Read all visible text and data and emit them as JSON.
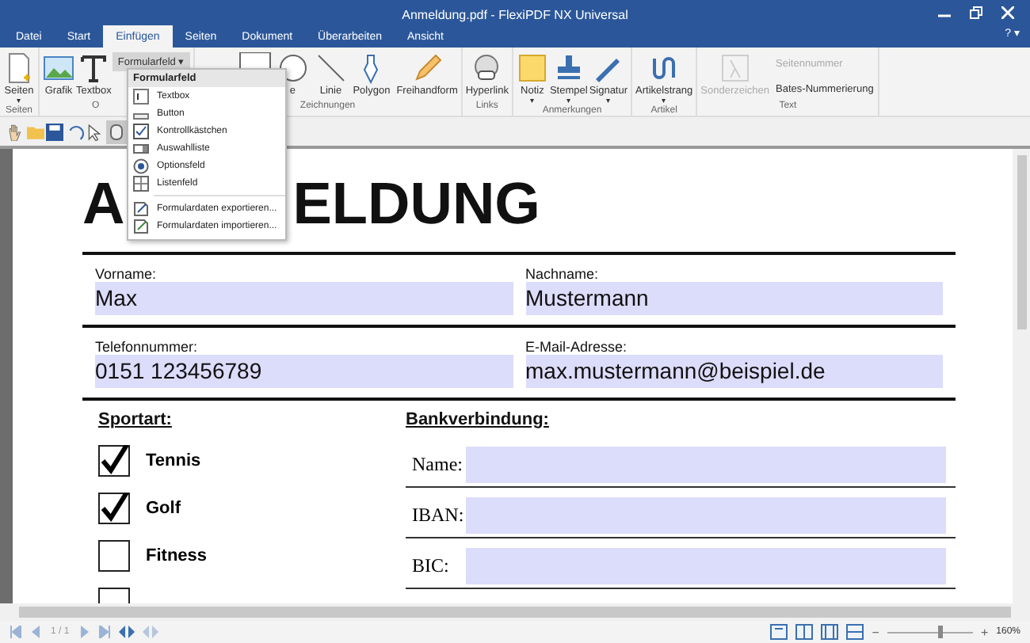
{
  "window": {
    "title": "Anmeldung.pdf - FlexiPDF NX Universal",
    "help": "? ▾"
  },
  "tabs": [
    {
      "label": "Datei",
      "selected": false
    },
    {
      "label": "Start",
      "selected": false
    },
    {
      "label": "Einfügen",
      "selected": true
    },
    {
      "label": "Seiten",
      "selected": false
    },
    {
      "label": "Dokument",
      "selected": false
    },
    {
      "label": "Überarbeiten",
      "selected": false
    },
    {
      "label": "Ansicht",
      "selected": false
    }
  ],
  "ribbon": [
    {
      "label": "Seiten",
      "items": [
        {
          "label": "Seiten",
          "kind": "page",
          "dropdown": "▾"
        }
      ]
    },
    {
      "label": "O",
      "items": [
        {
          "label": "Grafik",
          "kind": "image"
        },
        {
          "label": "Textbox",
          "kind": "text"
        },
        {
          "label": "Formularfeld ▾",
          "kind": "form"
        }
      ]
    },
    {
      "label": "Zeichnungen",
      "items": [
        {
          "kind": "rect"
        },
        {
          "label": "e",
          "kind": "ellipse"
        },
        {
          "label": "Linie",
          "kind": "line"
        },
        {
          "label": "Polygon",
          "kind": "pen"
        },
        {
          "label": "Freihandform",
          "kind": "pencil"
        }
      ]
    },
    {
      "label": "Links",
      "items": [
        {
          "label": "Hyperlink",
          "kind": "globe"
        }
      ]
    },
    {
      "label": "Anmerkungen",
      "items": [
        {
          "label": "Notiz",
          "kind": "note",
          "dropdown": "▾"
        },
        {
          "label": "Stempel",
          "kind": "stamp",
          "dropdown": "▾"
        },
        {
          "label": "Signatur",
          "kind": "sign",
          "dropdown": "▾"
        }
      ]
    },
    {
      "label": "Artikel",
      "items": [
        {
          "label": "Artikelstrang",
          "kind": "thread",
          "dropdown": "▾"
        }
      ]
    },
    {
      "label": "Text",
      "items": [
        {
          "label": "Sonderzeichen",
          "kind": "lambda",
          "disabled": true
        },
        {
          "label": "Seitennummer",
          "kind": "small",
          "disabled": true
        },
        {
          "label": "Bates-Nummerierung",
          "kind": "bates",
          "disabled": false
        }
      ]
    }
  ],
  "menu": {
    "title": "Formularfeld",
    "items": [
      {
        "label": "Textbox",
        "kind": "textbox"
      },
      {
        "label": "Button",
        "kind": "button"
      },
      {
        "label": "Kontrollkästchen",
        "kind": "checkbox"
      },
      {
        "label": "Auswahlliste",
        "kind": "combo"
      },
      {
        "label": "Optionsfeld",
        "kind": "radio"
      },
      {
        "label": "Listenfeld",
        "kind": "list"
      },
      {
        "label": "Formulardaten exportieren...",
        "kind": "export"
      },
      {
        "label": "Formulardaten importieren...",
        "kind": "import"
      }
    ]
  },
  "document": {
    "heading_parts": [
      "A",
      "ELDUNG"
    ],
    "field_rows": [
      [
        {
          "label": "Vorname:",
          "value": "Max"
        },
        {
          "label": "Nachname:",
          "value": "Mustermann"
        }
      ],
      [
        {
          "label": "Telefonnummer:",
          "value": "0151 123456789"
        },
        {
          "label": "E-Mail-Adresse:",
          "value": "max.mustermann@beispiel.de"
        }
      ]
    ],
    "sport": {
      "title": "Sportart:",
      "options": [
        {
          "label": "Tennis",
          "checked": true
        },
        {
          "label": "Golf",
          "checked": true
        },
        {
          "label": "Fitness",
          "checked": false
        },
        {
          "checked": false
        }
      ]
    },
    "bank": {
      "title": "Bankverbindung:",
      "fields": [
        {
          "label": "Name:"
        },
        {
          "label": "IBAN:"
        },
        {
          "label": "BIC:"
        }
      ]
    }
  },
  "status_bar": {
    "page": "1 / 1",
    "zoom_out": "−",
    "zoom_in": "+",
    "zoom": {
      "level": 0.62
    },
    "zoom_value": "160%"
  }
}
